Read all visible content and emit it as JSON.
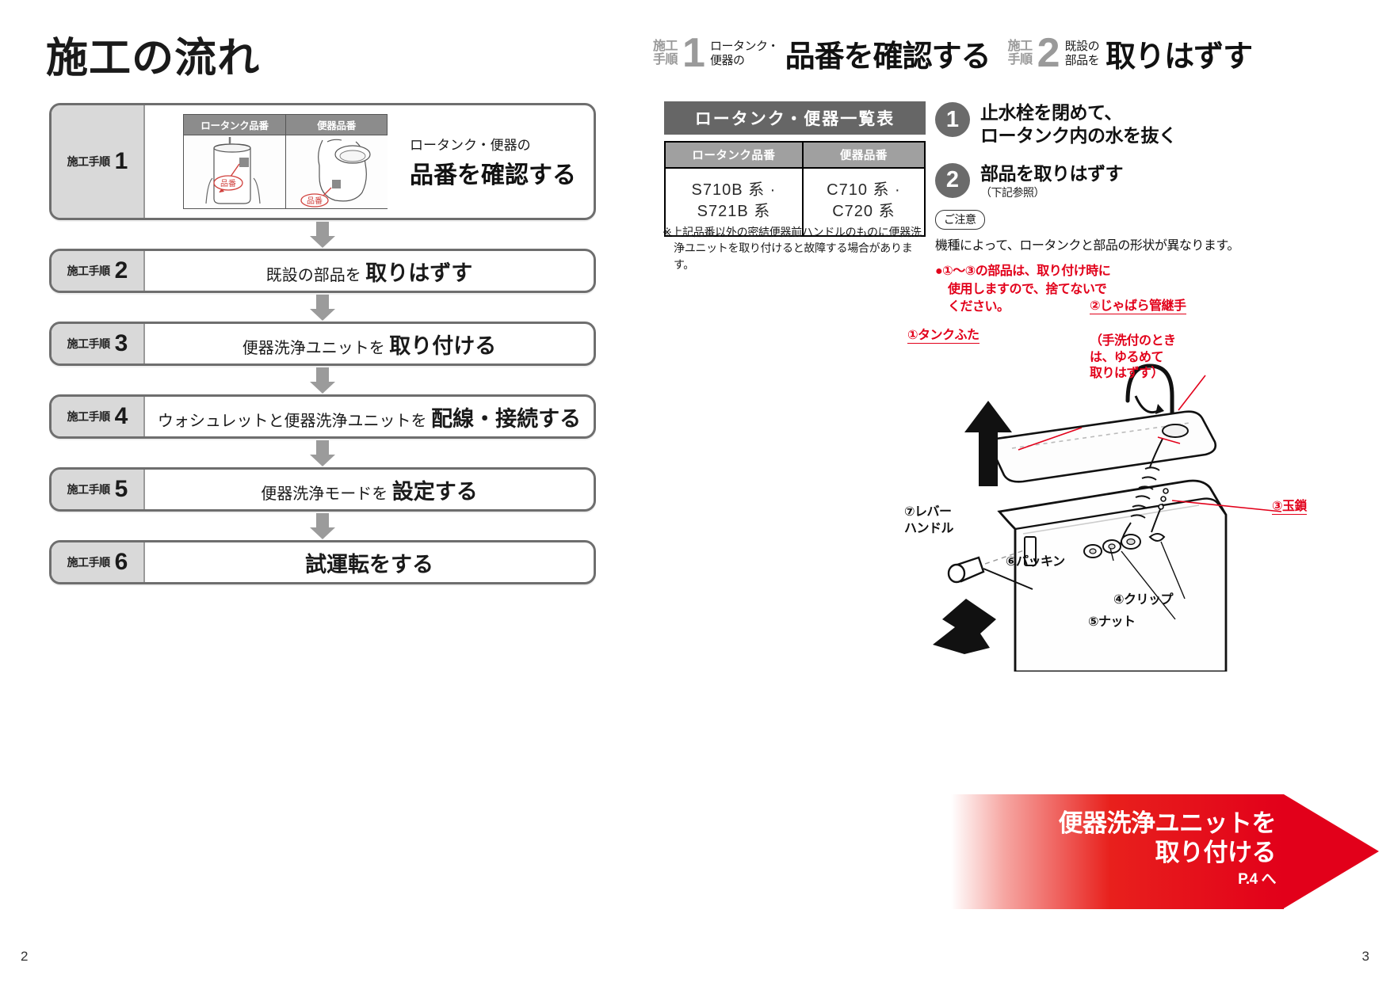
{
  "left": {
    "title": "施工の流れ",
    "page_number": "2",
    "step_tag_label": "施工手順",
    "step1": {
      "number": "1",
      "photo_caption_tank": "ロータンク品番",
      "photo_caption_bowl": "便器品番",
      "photo_badge": "品番",
      "lead": "ロータンク・便器の",
      "main": "品番を確認する"
    },
    "steps": [
      {
        "number": "2",
        "normal": "既設の部品を ",
        "emphasis": "取りはずす"
      },
      {
        "number": "3",
        "normal": "便器洗浄ユニットを ",
        "emphasis": "取り付ける"
      },
      {
        "number": "4",
        "normal": "ウォシュレットと便器洗浄ユニットを ",
        "emphasis": "配線・接続する"
      },
      {
        "number": "5",
        "normal": "便器洗浄モードを ",
        "emphasis": "設定する"
      },
      {
        "number": "6",
        "normal": "",
        "emphasis": "試運転をする"
      }
    ]
  },
  "right": {
    "page_number": "3",
    "header": [
      {
        "tag_line1": "施工",
        "tag_line2": "手順",
        "number": "1",
        "sub_line1": "ロータンク・",
        "sub_line2": "便器の",
        "main": "品番を確認する"
      },
      {
        "tag_line1": "施工",
        "tag_line2": "手順",
        "number": "2",
        "sub_line1": "既設の",
        "sub_line2": "部品を",
        "main": "取りはずす"
      }
    ],
    "table": {
      "title": "ロータンク・便器一覧表",
      "headers": [
        "ロータンク品番",
        "便器品番"
      ],
      "rows": [
        [
          "S710B 系 ·\nS721B 系",
          "C710 系 ·\nC720 系"
        ]
      ],
      "note": "※上記品番以外の密結便器前ハンドルのものに便器洗浄ユニットを取り付けると故障する場合があります。"
    },
    "procedure": [
      {
        "number": "1",
        "text": "止水栓を閉めて、\nロータンク内の水を抜く",
        "sub": ""
      },
      {
        "number": "2",
        "text": "部品を取りはずす",
        "sub": "（下記参照）"
      }
    ],
    "caution": {
      "tag": "ご注意",
      "body": "機種によって、ロータンクと部品の形状が異なります。",
      "red_line1": "①～③の部品は、取り付け時に",
      "red_line2": "使用しますので、捨てないで",
      "red_line3": "ください。"
    },
    "diagram_labels": [
      {
        "id": "tank-lid",
        "text": "①タンクふた",
        "color": "red"
      },
      {
        "id": "bellows-joint",
        "text": "②じゃばら管継手",
        "color": "red"
      },
      {
        "id": "bellows-joint-note",
        "text": "（手洗付のとき\nは、ゆるめて\n取りはずす）",
        "color": "red"
      },
      {
        "id": "bead-chain",
        "text": "③玉鎖",
        "color": "red"
      },
      {
        "id": "clip",
        "text": "④クリップ",
        "color": "black"
      },
      {
        "id": "nut",
        "text": "⑤ナット",
        "color": "black"
      },
      {
        "id": "packing",
        "text": "⑥パッキン",
        "color": "black"
      },
      {
        "id": "lever-handle",
        "text": "⑦レバー\nハンドル",
        "color": "black"
      }
    ],
    "banner": {
      "line1": "便器洗浄ユニットを",
      "line2": "取り付ける",
      "page_ref": "P.4 へ"
    }
  },
  "colors": {
    "red": "#e2001a",
    "gray_tag": "#d9d9d9",
    "gray_header": "#666666",
    "gray_th": "#a0a0a0",
    "border": "#6e6e6e"
  }
}
